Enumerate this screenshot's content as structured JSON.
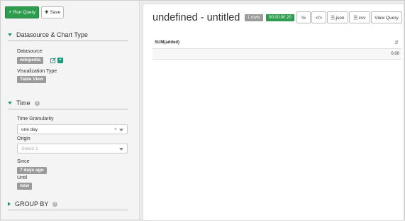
{
  "toolbar": {
    "run_label": "Run Query",
    "save_label": "Save"
  },
  "sections": {
    "datasource": {
      "title": "Datasource & Chart Type",
      "datasource_label": "Datasource",
      "datasource_value": "wikipedia",
      "viz_label": "Visualization Type",
      "viz_value": "Table View"
    },
    "time": {
      "title": "Time",
      "granularity_label": "Time Granularity",
      "granularity_value": "one day",
      "clear_glyph": "×",
      "origin_label": "Origin",
      "origin_placeholder": "Select 2",
      "since_label": "Since",
      "since_value": "7 days ago",
      "until_label": "Until",
      "until_value": "now"
    },
    "group_by": {
      "title": "GROUP BY"
    }
  },
  "main": {
    "title": "undefined - untitled",
    "rows_badge": "1 rows",
    "time_badge": "00:00:00.20",
    "buttons": {
      "link": "%",
      "embed": "</>",
      "json": ".json",
      "csv": ".csv",
      "view_query": "View Query"
    },
    "table": {
      "columns": [
        "SUM(added)"
      ],
      "rows": [
        [
          "0.00"
        ]
      ]
    }
  },
  "colors": {
    "accent": "#1d9a7a",
    "run_green": "#2d9c4f",
    "tag_gray": "#9b9b9b"
  }
}
